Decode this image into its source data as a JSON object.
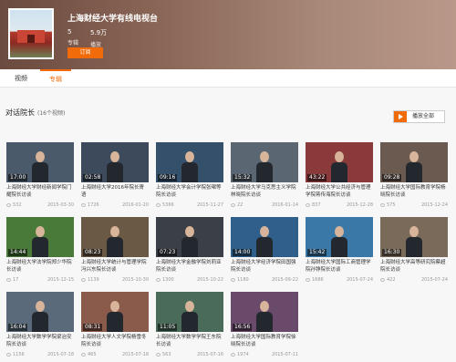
{
  "channel": {
    "title": "上海财经大学有线电视台",
    "videos_count": "5",
    "videos_label": "专辑",
    "plays_count": "5.9万",
    "plays_label": "播放",
    "subscribe_label": "订阅"
  },
  "tabs": [
    {
      "label": "视频"
    },
    {
      "label": "专辑"
    }
  ],
  "section": {
    "title": "对话院长",
    "count": "(16个视频)",
    "play_all": "播放全部"
  },
  "videos": [
    {
      "duration": "17:00",
      "title": "上海财经大学财经新闻学院门耀院长访谈",
      "views": "532",
      "date": "2015-03-30",
      "bg": "#4a5a6a"
    },
    {
      "duration": "02:58",
      "title": "上海财经大学2016年院长寄语",
      "views": "1726",
      "date": "2016-01-20",
      "bg": "#3c4a5c"
    },
    {
      "duration": "09:16",
      "title": "上海财经大学会计学院张珺等院长访谈",
      "views": "5366",
      "date": "2015-11-27",
      "bg": "#35506b"
    },
    {
      "duration": "15:32",
      "title": "上海财经大学马克思主义学院林晓院长访谈",
      "views": "22",
      "date": "2016-01-14",
      "bg": "#5a6672"
    },
    {
      "duration": "43:22",
      "title": "上海财经大学公共经济与管理学院蒋传海院长访谈",
      "views": "837",
      "date": "2015-12-28",
      "bg": "#8a3a3a"
    },
    {
      "duration": "09:28",
      "title": "上海财经大学国际教育学院杨晓院长访谈",
      "views": "575",
      "date": "2015-12-24",
      "bg": "#6a5a50"
    },
    {
      "duration": "14:44",
      "title": "上海财经大学法学院郑少华院长访谈",
      "views": "17",
      "date": "2015-12-15",
      "bg": "#4a7a3a"
    },
    {
      "duration": "08:23",
      "title": "上海财经大学统计与管理学院冯兴东院长访谈",
      "views": "1139",
      "date": "2015-10-30",
      "bg": "#6a5a45"
    },
    {
      "duration": "07:23",
      "title": "上海财经大学金融学院刘莉亚院长访谈",
      "views": "1300",
      "date": "2015-10-22",
      "bg": "#3a3f48"
    },
    {
      "duration": "14:00",
      "title": "上海财经大学经济学院田国强院长访谈",
      "views": "1180",
      "date": "2015-09-22",
      "bg": "#2f5f8a"
    },
    {
      "duration": "15:42",
      "title": "上海财经大学国际工商管理学院孙铮院长访谈",
      "views": "1686",
      "date": "2015-07-24",
      "bg": "#3a78a8"
    },
    {
      "duration": "16:30",
      "title": "上海财经大学高等研究院蔡超院长访谈",
      "views": "422",
      "date": "2015-07-24",
      "bg": "#7a6a5a"
    },
    {
      "duration": "16:04",
      "title": "上海财经大学数学学院梁治安院长访谈",
      "views": "1156",
      "date": "2015-07-18",
      "bg": "#5a6a7a"
    },
    {
      "duration": "08:31",
      "title": "上海财经大学人文学院杨雪冬院长访谈",
      "views": "465",
      "date": "2015-07-18",
      "bg": "#8a5a4a"
    },
    {
      "duration": "11:05",
      "title": "上海财经大学数学学院王东院长访谈",
      "views": "563",
      "date": "2015-07-16",
      "bg": "#4a6a5a"
    },
    {
      "duration": "16:56",
      "title": "上海财经大学国际教育学院徐晓院长访谈",
      "views": "1974",
      "date": "2015-07-11",
      "bg": "#6a4a6a"
    }
  ]
}
